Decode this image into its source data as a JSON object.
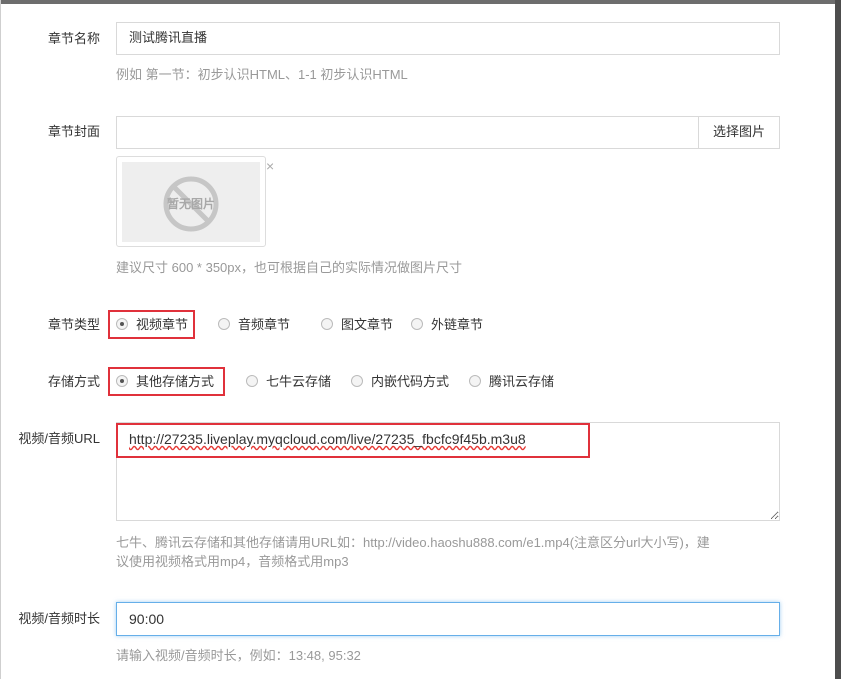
{
  "chapter_name": {
    "label": "章节名称",
    "value": "测试腾讯直播",
    "help": "例如 第一节：初步认识HTML、1-1 初步认识HTML"
  },
  "chapter_cover": {
    "label": "章节封面",
    "value": "",
    "select_button": "选择图片",
    "placeholder_image_text": "暂无图片",
    "remove_icon": "×",
    "help": "建议尺寸 600 * 350px，也可根据自己的实际情况做图片尺寸"
  },
  "chapter_type": {
    "label": "章节类型",
    "options": [
      "视频章节",
      "音频章节",
      "图文章节",
      "外链章节"
    ],
    "selected_index": 0
  },
  "storage_method": {
    "label": "存储方式",
    "options": [
      "其他存储方式",
      "七牛云存储",
      "内嵌代码方式",
      "腾讯云存储"
    ],
    "selected_index": 0
  },
  "media_url": {
    "label": "视频/音频URL",
    "value": "http://27235.liveplay.myqcloud.com/live/27235_fbcfc9f45b.m3u8",
    "help_line1": "七牛、腾讯云存储和其他存储请用URL如：http://video.haoshu888.com/e1.mp4(注意区分url大小写)，建",
    "help_line2": "议使用视频格式用mp4，音频格式用mp3"
  },
  "media_duration": {
    "label": "视频/音频时长",
    "value": "90:00",
    "help": "请输入视频/音频时长，例如：13:48, 95:32"
  },
  "colors": {
    "highlight": "#e0313b",
    "focus_border": "#66afe9",
    "help_text": "#999999"
  }
}
